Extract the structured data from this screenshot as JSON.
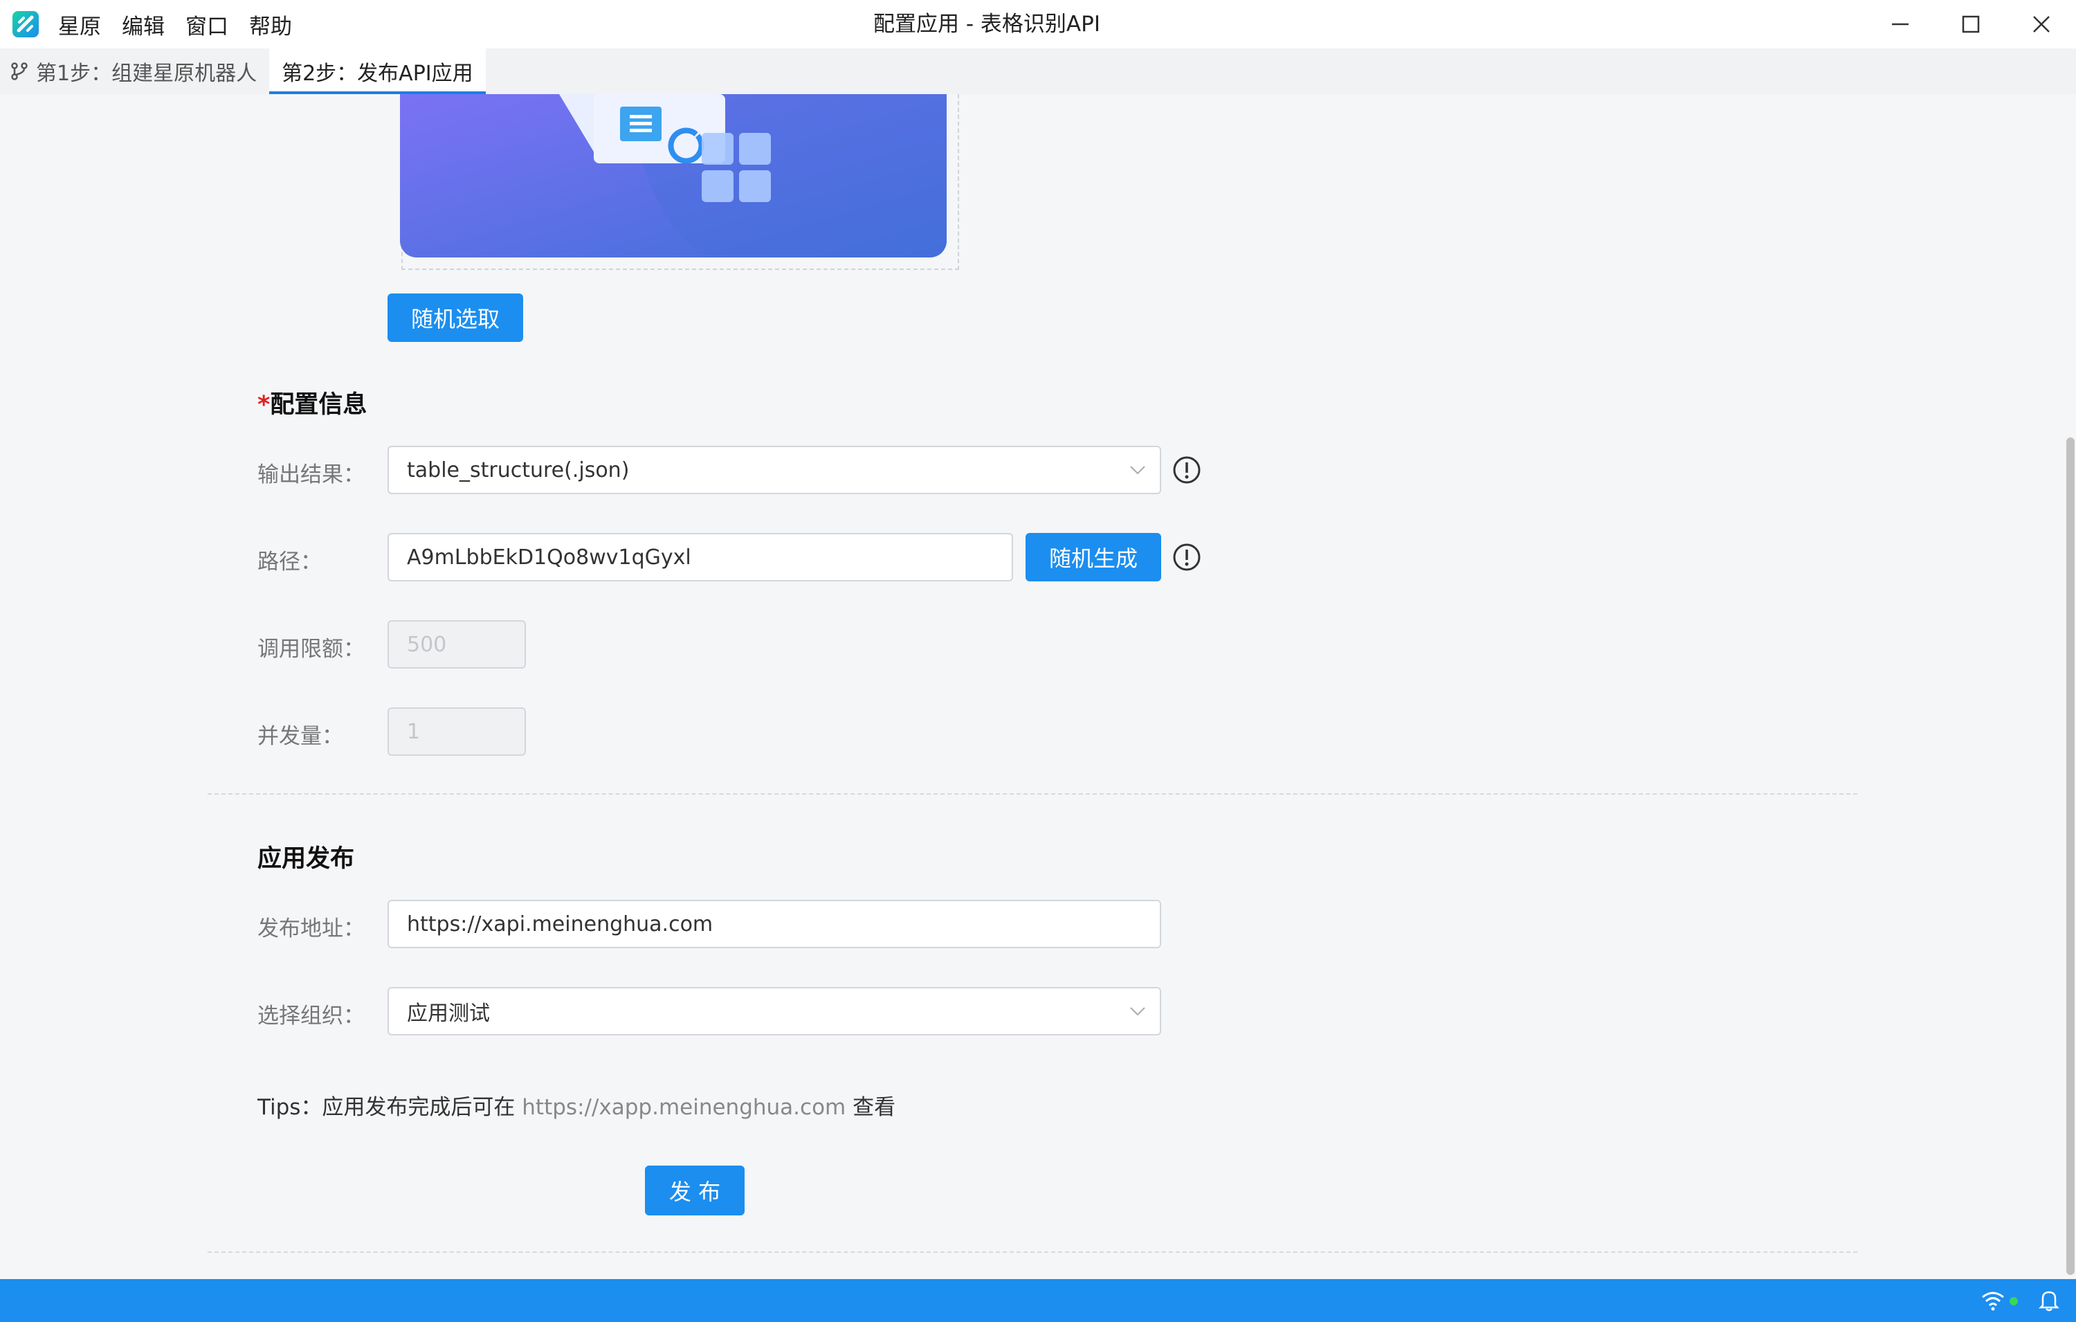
{
  "menu": [
    "星原",
    "编辑",
    "窗口",
    "帮助"
  ],
  "window": {
    "title": "配置应用 - 表格识别API"
  },
  "tabs": [
    {
      "label": "第1步：组建星原机器人",
      "active": false
    },
    {
      "label": "第2步：发布API应用",
      "active": true
    }
  ],
  "cover": {
    "random_button": "随机选取"
  },
  "config": {
    "title_required_mark": "*",
    "title": "配置信息",
    "output_label": "输出结果：",
    "output_value": "table_structure(.json)",
    "path_label": "路径：",
    "path_value": "A9mLbbEkD1Qo8wv1qGyxl",
    "path_generate_button": "随机生成",
    "limit_label": "调用限额：",
    "limit_placeholder": "500",
    "concurrency_label": "并发量：",
    "concurrency_placeholder": "1"
  },
  "publish": {
    "title": "应用发布",
    "address_label": "发布地址：",
    "address_value": "https://xapi.meinenghua.com",
    "org_label": "选择组织：",
    "org_value": "应用测试",
    "tips_prefix": "Tips：应用发布完成后可在 ",
    "tips_url": "https://xapp.meinenghua.com",
    "tips_suffix": " 查看",
    "submit_button": "发 布"
  },
  "colors": {
    "accent": "#1b8ef0",
    "status_bar": "#1b8ef0",
    "required": "#e02020",
    "online": "#3ad65a"
  }
}
